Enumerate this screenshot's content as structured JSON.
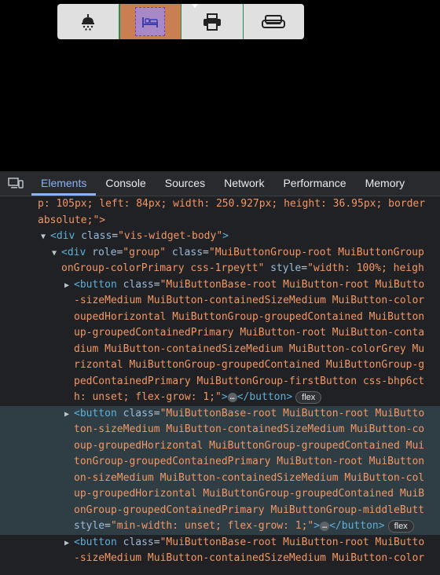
{
  "widget": {
    "buttons": [
      {
        "icon": "shower-icon"
      },
      {
        "icon": "bed-icon",
        "active": true
      },
      {
        "icon": "printer-icon"
      },
      {
        "icon": "sofa-icon"
      }
    ]
  },
  "devtools": {
    "tabs": [
      "Elements",
      "Console",
      "Sources",
      "Network",
      "Performance",
      "Memory"
    ],
    "active_tab": "Elements",
    "lines": {
      "l1": "p: 105px; left: 84px; width: 250.927px; height: 36.95px; border",
      "l2": "absolute;\">",
      "l3_tag_open": "<div ",
      "l3_attr": "class",
      "l3_val": "\"vis-widget-body\"",
      "l3_close": ">",
      "l4_tag": "<div ",
      "l4_attr1": "role",
      "l4_val1": "\"group\"",
      "l4_attr2": "class",
      "l4_val2": "\"MuiButtonGroup-root MuiButtonGroup",
      "l5_val": "onGroup-colorPrimary css-1rpeytt\"",
      "l5_attr": "style",
      "l5_val2": "\"width: 100%; heigh",
      "b1_l1_tag": "<button ",
      "b1_l1_attr": "class",
      "b1_l1_val": "\"MuiButtonBase-root MuiButton-root MuiButto",
      "b1_l2": "-sizeMedium MuiButton-containedSizeMedium MuiButton-color",
      "b1_l3": "oupedHorizontal MuiButtonGroup-groupedContained MuiButton",
      "b1_l4": "up-groupedContainedPrimary MuiButton-root MuiButton-conta",
      "b1_l5": "dium MuiButton-containedSizeMedium MuiButton-colorGrey Mu",
      "b1_l6": "rizontal MuiButtonGroup-groupedContained MuiButtonGroup-g",
      "b1_l7": "pedContainedPrimary MuiButtonGroup-firstButton css-bhp6ct",
      "b1_l8_val": "h: unset; flex-grow: 1;\"",
      "b1_l8_close": ">",
      "b1_l8_end": "</button>",
      "ellipsis": "…",
      "flex_badge": "flex",
      "b2_l1_tag": "<button ",
      "b2_l1_attr": "class",
      "b2_l1_val": "\"MuiButtonBase-root MuiButton-root MuiButto",
      "b2_l2": "ton-sizeMedium MuiButton-containedSizeMedium MuiButton-co",
      "b2_l3": "oup-groupedHorizontal MuiButtonGroup-groupedContained Mui",
      "b2_l4": "tonGroup-groupedContainedPrimary MuiButton-root MuiButton",
      "b2_l5": "on-sizeMedium MuiButton-containedSizeMedium MuiButton-col",
      "b2_l6": "up-groupedHorizontal MuiButtonGroup-groupedContained MuiB",
      "b2_l7": "onGroup-groupedContainedPrimary MuiButtonGroup-middleButt",
      "b2_l8_attr": "style",
      "b2_l8_val": "\"min-width: unset; flex-grow: 1;\"",
      "b2_l8_close": ">",
      "b2_l8_end": "</button>",
      "b3_l1_tag": "<button ",
      "b3_l1_attr": "class",
      "b3_l1_val": "\"MuiButtonBase-root MuiButton-root MuiButto",
      "b3_l2": "-sizeMedium MuiButton-containedSizeMedium MuiButton-color"
    }
  }
}
